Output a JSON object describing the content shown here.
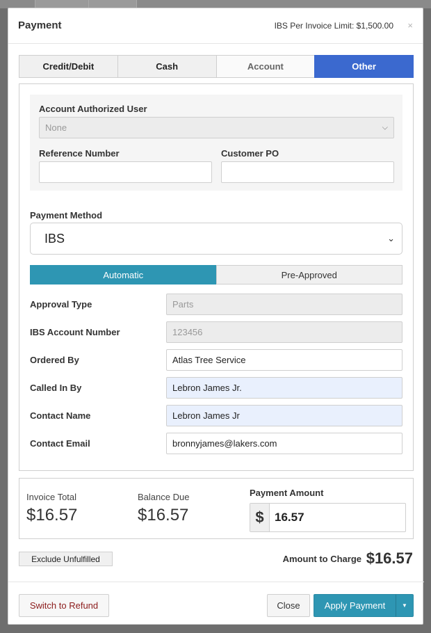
{
  "header": {
    "title": "Payment",
    "limit_text": "IBS Per Invoice Limit: $1,500.00",
    "close_glyph": "×"
  },
  "tabs": [
    {
      "label": "Credit/Debit",
      "state": "default"
    },
    {
      "label": "Cash",
      "state": "default"
    },
    {
      "label": "Account",
      "state": "dim"
    },
    {
      "label": "Other",
      "state": "active"
    }
  ],
  "account": {
    "authorized_user_label": "Account Authorized User",
    "authorized_user_value": "None",
    "reference_number_label": "Reference Number",
    "reference_number_value": "",
    "customer_po_label": "Customer PO",
    "customer_po_value": ""
  },
  "payment_method": {
    "label": "Payment Method",
    "value": "IBS"
  },
  "approval_toggle": {
    "options": [
      "Automatic",
      "Pre-Approved"
    ],
    "selected": "Automatic"
  },
  "fields": [
    {
      "label": "Approval Type",
      "value": "Parts",
      "state": "disabled"
    },
    {
      "label": "IBS Account Number",
      "value": "123456",
      "state": "disabled"
    },
    {
      "label": "Ordered By",
      "value": "Atlas Tree Service",
      "state": "normal"
    },
    {
      "label": "Called In By",
      "value": "Lebron James Jr.",
      "state": "highlighted"
    },
    {
      "label": "Contact Name",
      "value": "Lebron James Jr",
      "state": "highlighted"
    },
    {
      "label": "Contact Email",
      "value": "bronnyjames@lakers.com",
      "state": "normal"
    }
  ],
  "summary": {
    "invoice_total_label": "Invoice Total",
    "invoice_total_value": "$16.57",
    "balance_due_label": "Balance Due",
    "balance_due_value": "$16.57",
    "payment_amount_label": "Payment Amount",
    "currency_symbol": "$",
    "payment_amount_value": "16.57"
  },
  "exclude_unfulfilled_label": "Exclude Unfulfilled",
  "amount_to_charge_label": "Amount to Charge",
  "amount_to_charge_value": "$16.57",
  "footer": {
    "refund_label": "Switch to Refund",
    "close_label": "Close",
    "apply_label": "Apply Payment"
  },
  "colors": {
    "tab_active": "#3b69cf",
    "primary": "#2e96b3",
    "highlight_input": "#e9f0fd",
    "refund_text": "#8b1a1a"
  }
}
